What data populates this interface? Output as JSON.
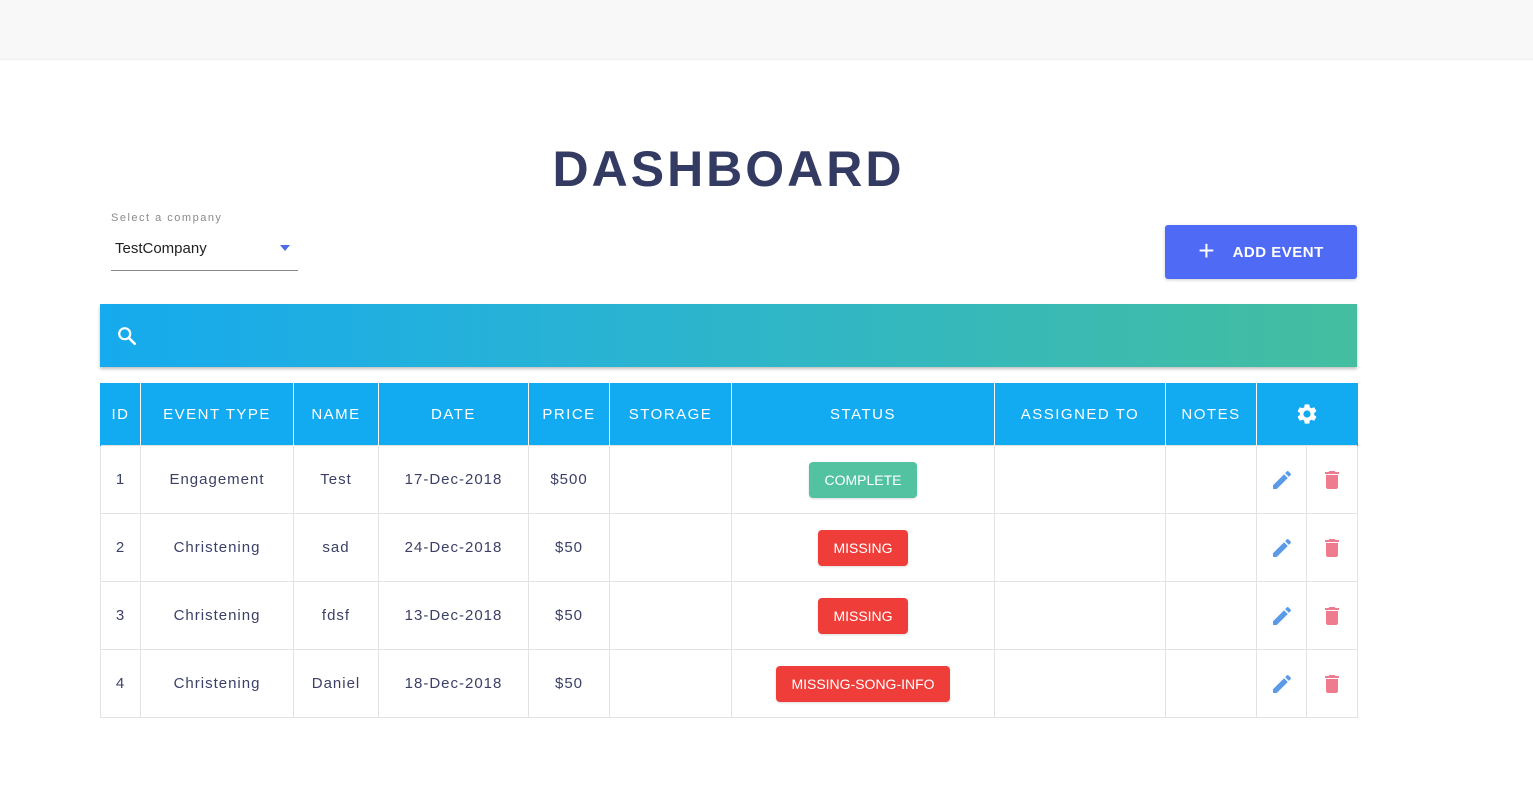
{
  "page": {
    "title": "DASHBOARD"
  },
  "company_select": {
    "label": "Select a company",
    "value": "TestCompany"
  },
  "actions": {
    "add_event_label": "ADD EVENT"
  },
  "search": {
    "placeholder": ""
  },
  "colors": {
    "accent": "#4f6bf5",
    "header_bg": "#12aaf1",
    "title": "#343b63",
    "status_complete": "#52c2a0",
    "status_missing": "#ef3e3a",
    "edit_icon": "#5a9ae6",
    "delete_icon": "#ef7c8e"
  },
  "table": {
    "columns": [
      "ID",
      "EVENT TYPE",
      "NAME",
      "DATE",
      "PRICE",
      "STORAGE",
      "STATUS",
      "ASSIGNED TO",
      "NOTES"
    ],
    "settings_icon": "gear-icon",
    "rows": [
      {
        "id": "1",
        "event_type": "Engagement",
        "name": "Test",
        "date": "17-Dec-2018",
        "price": "$500",
        "storage": "",
        "status": "COMPLETE",
        "status_color": "#52c2a0",
        "assigned_to": "",
        "notes": ""
      },
      {
        "id": "2",
        "event_type": "Christening",
        "name": "sad",
        "date": "24-Dec-2018",
        "price": "$50",
        "storage": "",
        "status": "MISSING",
        "status_color": "#ef3e3a",
        "assigned_to": "",
        "notes": ""
      },
      {
        "id": "3",
        "event_type": "Christening",
        "name": "fdsf",
        "date": "13-Dec-2018",
        "price": "$50",
        "storage": "",
        "status": "MISSING",
        "status_color": "#ef3e3a",
        "assigned_to": "",
        "notes": ""
      },
      {
        "id": "4",
        "event_type": "Christening",
        "name": "Daniel",
        "date": "18-Dec-2018",
        "price": "$50",
        "storage": "",
        "status": "MISSING-SONG-INFO",
        "status_color": "#ef3e3a",
        "assigned_to": "",
        "notes": ""
      }
    ]
  }
}
